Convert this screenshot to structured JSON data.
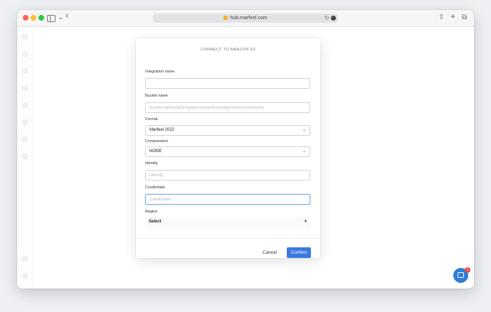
{
  "browser": {
    "url": "hub.marfeel.com",
    "back_glyph": "‹",
    "reload_glyph": "↻",
    "share_glyph": "⇧",
    "newtab_glyph": "+",
    "tabs_glyph": "⧉",
    "chevron_glyph": "⌄"
  },
  "modal": {
    "title": "CONNECT TO AMAZON S3",
    "fields": {
      "integration_name": {
        "label": "Integration name",
        "value": "",
        "placeholder": ""
      },
      "bucket_name": {
        "label": "Bucket name",
        "value": "",
        "placeholder": "bucket-name/path/#{year}/#{month}/#{day}/#{hour}/#{minute}"
      },
      "format": {
        "label": "Format",
        "value": "Marfeel 2022"
      },
      "compression": {
        "label": "Compression",
        "value": "NONE"
      },
      "identity": {
        "label": "Identity",
        "value": "",
        "placeholder": "Identity"
      },
      "credentials": {
        "label": "Credentials",
        "value": "",
        "placeholder": "Credentials"
      },
      "region": {
        "label": "Region",
        "value": "Select"
      }
    },
    "cancel_label": "Cancel",
    "confirm_label": "Confirm",
    "select_chevron": "⌄",
    "region_caret": "▾"
  },
  "chat": {
    "badge": "1"
  },
  "colors": {
    "accent": "#3b79e0",
    "chat": "#2e7dd7",
    "badge": "#e54848"
  }
}
